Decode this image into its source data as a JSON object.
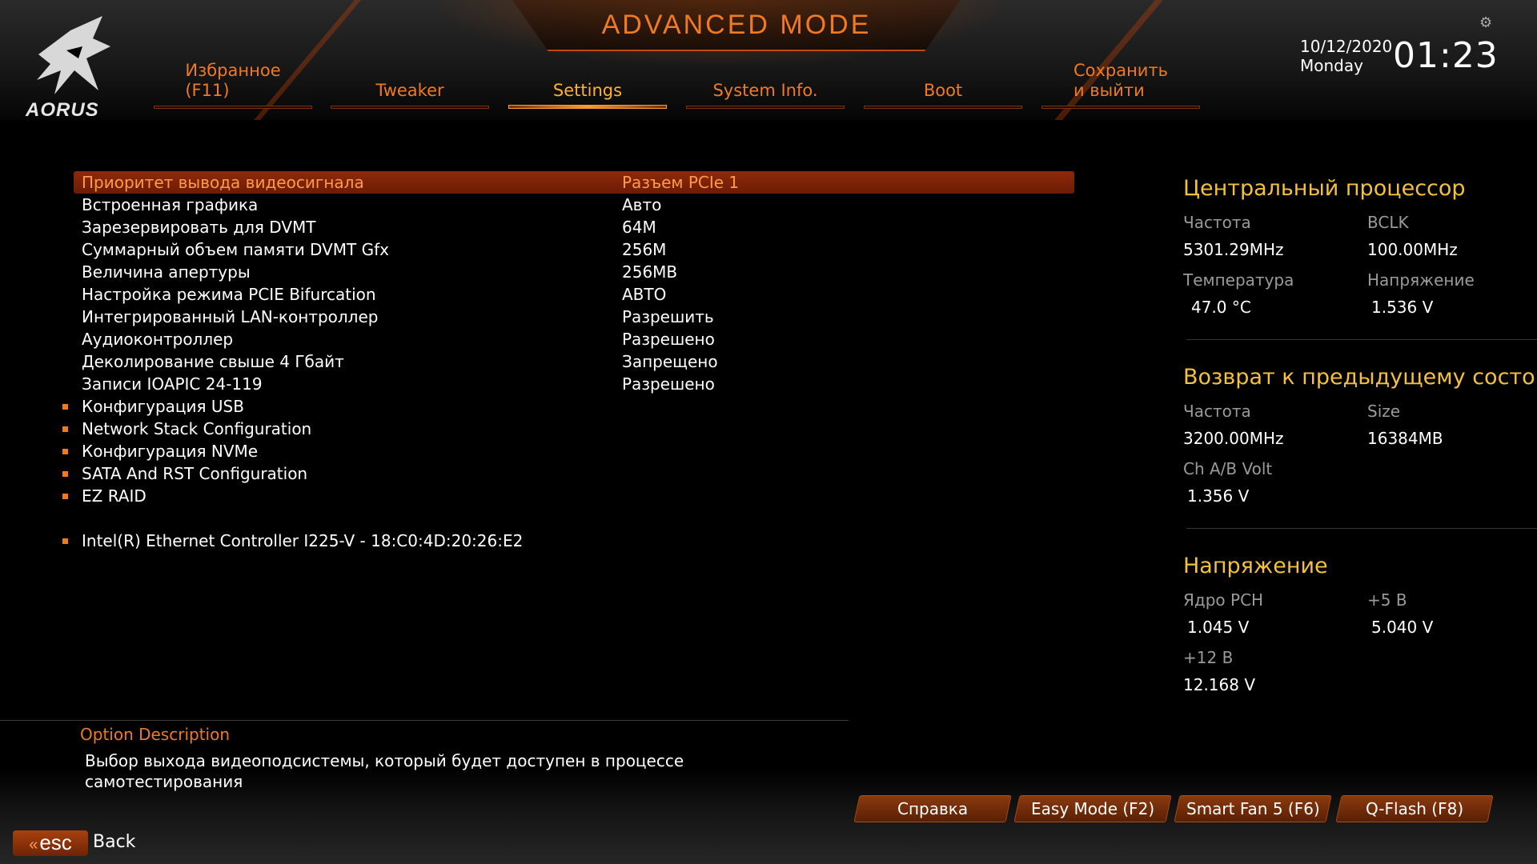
{
  "header": {
    "title": "ADVANCED MODE",
    "logo_text": "AORUS",
    "date": "10/12/2020",
    "day": "Monday",
    "time": "01:23"
  },
  "tabs": [
    {
      "line1": "Избранное",
      "line2": "(F11)",
      "active": false
    },
    {
      "line1": "Tweaker",
      "line2": "",
      "active": false
    },
    {
      "line1": "Settings",
      "line2": "",
      "active": true
    },
    {
      "line1": "System Info.",
      "line2": "",
      "active": false
    },
    {
      "line1": "Boot",
      "line2": "",
      "active": false
    },
    {
      "line1": "Сохранить",
      "line2": "и выйти",
      "active": false
    }
  ],
  "settings": [
    {
      "label": "Приоритет вывода видеосигнала",
      "value": "Разъем PCIe 1",
      "selected": true
    },
    {
      "label": "Встроенная графика",
      "value": "Авто"
    },
    {
      "label": "Зарезервировать для DVMT",
      "value": "64M"
    },
    {
      "label": "Суммарный объем памяти DVMT Gfx",
      "value": "256M"
    },
    {
      "label": "Величина апертуры",
      "value": "256MB"
    },
    {
      "label": "Настройка режима PCIE Bifurcation",
      "value": "АВТО"
    },
    {
      "label": "Интегрированный LAN-контроллер",
      "value": "Разрешить"
    },
    {
      "label": "Аудиоконтроллер",
      "value": "Разрешено"
    },
    {
      "label": "Деколирование свыше 4 Гбайт",
      "value": "Запрещено"
    },
    {
      "label": "Записи IOAPIC 24-119",
      "value": "Разрешено"
    }
  ],
  "submenus": [
    "Конфигурация USB",
    "Network Stack Configuration",
    "Конфигурация NVMe",
    "SATA And RST Configuration",
    "EZ RAID",
    "Intel(R) Ethernet Controller I225-V - 18:C0:4D:20:26:E2"
  ],
  "cpu": {
    "title": "Центральный процессор",
    "freq_label": "Частота",
    "freq": "5301.29MHz",
    "bclk_label": "BCLK",
    "bclk": "100.00MHz",
    "temp_label": "Температура",
    "temp": "47.0 °C",
    "volt_label": "Напряжение",
    "volt": "1.536 V"
  },
  "memory": {
    "title": "Возврат к предыдущему состоя",
    "freq_label": "Частота",
    "freq": "3200.00MHz",
    "size_label": "Size",
    "size": "16384MB",
    "volt_label": "Ch A/B Volt",
    "volt": "1.356 V"
  },
  "voltage": {
    "title": "Напряжение",
    "pch_label": "Ядро PCH",
    "pch": "1.045 V",
    "v5_label": "+5 В",
    "v5": "5.040 V",
    "v12_label": "+12 В",
    "v12": "12.168 V"
  },
  "description": {
    "title": "Option Description",
    "text": "Выбор выхода видеоподсистемы, который будет доступен в процессе самотестирования"
  },
  "footer": {
    "buttons": [
      "Справка",
      "Easy Mode (F2)",
      "Smart Fan 5 (F6)",
      "Q-Flash (F8)"
    ],
    "esc": "esc",
    "back": "Back"
  },
  "colors": {
    "accent": "#f07a22",
    "highlight": "#f5c13b",
    "selected_row": "#8e2a0a"
  },
  "icons": [
    "aorus-logo-icon",
    "gear-icon",
    "esc-arrow-icon"
  ]
}
